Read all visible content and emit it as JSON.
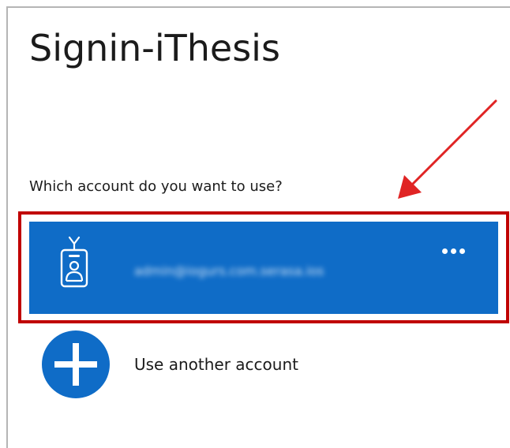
{
  "page": {
    "title": "Signin-iThesis",
    "prompt": "Which account do you want to use?"
  },
  "account_tile": {
    "email": "admin@iogurs.com.serasa.ios",
    "icon": "id-badge-icon",
    "more_icon": "more-dots-icon",
    "background": "#0f6cc7"
  },
  "add_account": {
    "label": "Use another account",
    "icon": "plus-circle-icon",
    "icon_color": "#0f6cc7"
  },
  "annotations": {
    "highlight_color": "#c00000",
    "arrow_color": "#e02424"
  }
}
